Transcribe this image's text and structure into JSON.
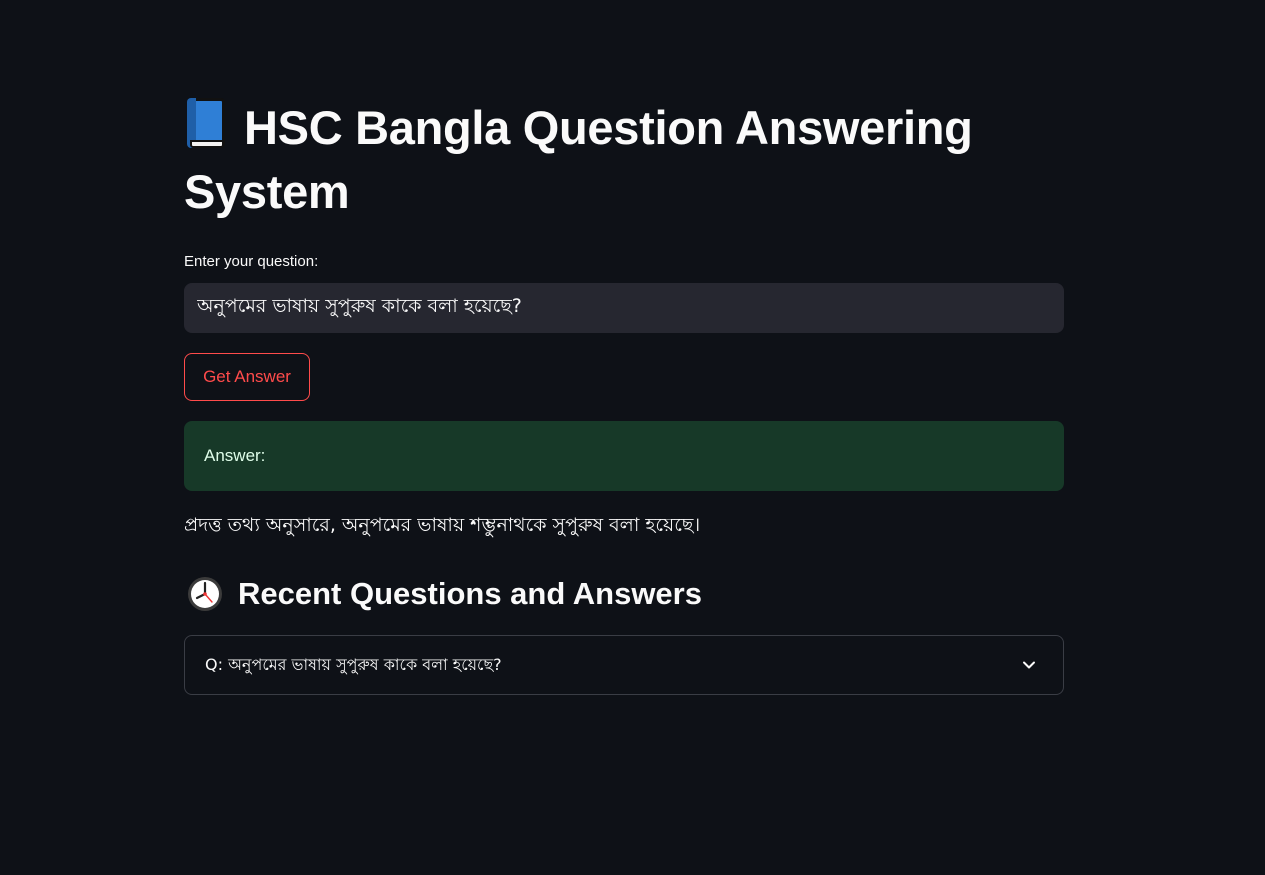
{
  "header": {
    "title": "HSC Bangla Question Answering System",
    "title_icon": "book-icon"
  },
  "question": {
    "label": "Enter your question:",
    "value": "অনুপমের ভাষায় সুপুরুষ কাকে বলা হয়েছে?"
  },
  "button": {
    "label": "Get Answer"
  },
  "answer": {
    "label": "Answer:",
    "text": "প্রদত্ত তথ্য অনুসারে, অনুপমের ভাষায় শম্ভুনাথকে সুপুরুষ বলা হয়েছে।"
  },
  "recent": {
    "heading": "Recent Questions and Answers",
    "heading_icon": "clock-icon",
    "items": [
      {
        "question": "Q: অনুপমের ভাষায় সুপুরুষ কাকে বলা হয়েছে?",
        "icon": "chevron-down-icon"
      }
    ]
  },
  "colors": {
    "background": "#0e1117",
    "input_bg": "#262730",
    "accent": "#ff4b4b",
    "success_bg": "#173928",
    "text": "#fafafa"
  }
}
